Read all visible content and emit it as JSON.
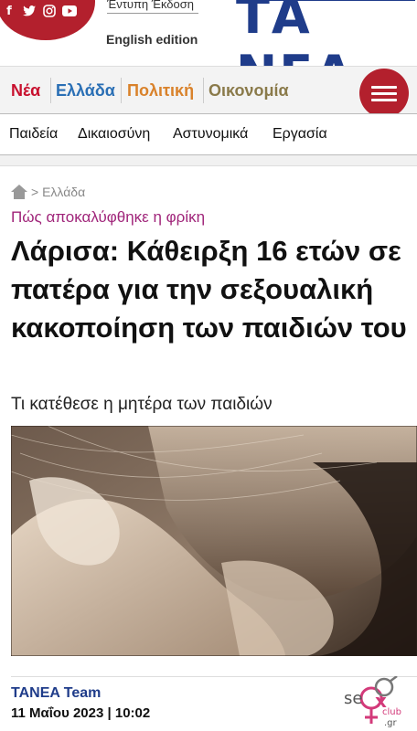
{
  "header": {
    "print_edition": "Έντυπη Έκδοση",
    "english_edition": "English edition",
    "logo": "ΤΑ ΝΕΑ",
    "social": [
      "facebook-icon",
      "twitter-icon",
      "instagram-icon",
      "youtube-icon"
    ],
    "colors": {
      "brand_red": "#b3202d",
      "brand_blue": "#1f3c8a"
    }
  },
  "nav": {
    "categories": [
      {
        "label": "Νέα",
        "color": "#c8102e"
      },
      {
        "label": "Ελλάδα",
        "color": "#2a6fb5"
      },
      {
        "label": "Πολιτική",
        "color": "#d9822b"
      },
      {
        "label": "Οικονομία",
        "color": "#8a7a4a"
      }
    ],
    "menu_icon": "hamburger-icon"
  },
  "subnav": {
    "items": [
      "Παιδεία",
      "Δικαιοσύνη",
      "Αστυνομικά",
      "Εργασία"
    ]
  },
  "article": {
    "breadcrumb": "> Ελλάδα",
    "kicker": "Πώς αποκαλύφθηκε η φρίκη",
    "headline": "Λάρισα: Κάθειρξη 16 ετών σε πατέρα για την σεξουαλική κακοποίηση των παιδιών του",
    "subtitle": "Τι κατέθεσε η μητέρα των παιδιών",
    "author": "TANEA Team",
    "date": "11 Μαΐου 2023 | 10:02",
    "kicker_color": "#a0257a"
  },
  "ad": {
    "line1": "se",
    "line2": "x",
    "line3": "club",
    "line4": ".gr"
  }
}
